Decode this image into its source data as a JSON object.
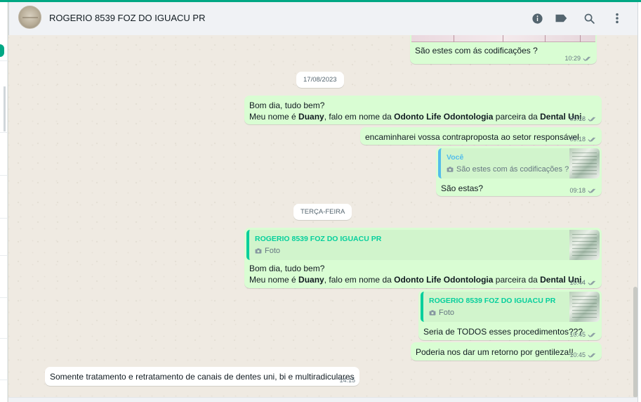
{
  "header": {
    "contact_name": "ROGERIO 8539 FOZ DO IGUACU PR",
    "icons": [
      "info-icon",
      "label-icon",
      "search-icon",
      "menu-icon"
    ]
  },
  "colors": {
    "accent": "#00a884",
    "outgoing_bubble": "#d9fdd3",
    "incoming_bubble": "#ffffff",
    "chat_background": "#efeae2",
    "quote_author_contact": "#06cf9c",
    "quote_author_you": "#53bdeb",
    "read_ticks": "#8696a0"
  },
  "messages": {
    "m1": {
      "text": "São estes com ás codificações ?",
      "time": "10:29"
    },
    "date1": "17/08/2023",
    "m2": {
      "line1": "Bom dia, tudo bem?",
      "p1": "Meu nome é ",
      "b1": "Duany",
      "p2": ", falo em nome da ",
      "b2": "Odonto Life Odontologia",
      "p3": " parceira da ",
      "b3": "Dental Uni",
      "p4": ".",
      "time": "09:18"
    },
    "m3": {
      "text": "encaminharei vossa contraproposta ao setor responsável",
      "time": "09:18"
    },
    "m4": {
      "quote_author": "Você",
      "quote_text": "São estes com ás codificações ?",
      "text": "São estas?",
      "time": "09:18"
    },
    "date2": "TERÇA-FEIRA",
    "m5": {
      "quote_author": "ROGERIO 8539 FOZ DO IGUACU PR",
      "quote_text": "Foto",
      "line1": "Bom dia, tudo bem?",
      "p1": "Meu nome é ",
      "b1": "Duany",
      "p2": ", falo em nome da ",
      "b2": "Odonto Life Odontologia",
      "p3": " parceira da ",
      "b3": "Dental Uni",
      "p4": ".",
      "time": "10:44"
    },
    "m6": {
      "quote_author": "ROGERIO 8539 FOZ DO IGUACU PR",
      "quote_text": "Foto",
      "text": "Seria de TODOS esses procedimentos???",
      "time": "10:45"
    },
    "m7": {
      "text": "Poderia nos dar um retorno por gentileza!!",
      "time": "10:45"
    },
    "m8": {
      "text": "Somente tratamento e retratamento de canais de dentes uni, bi e multiradiculares",
      "time": "14:15"
    }
  }
}
